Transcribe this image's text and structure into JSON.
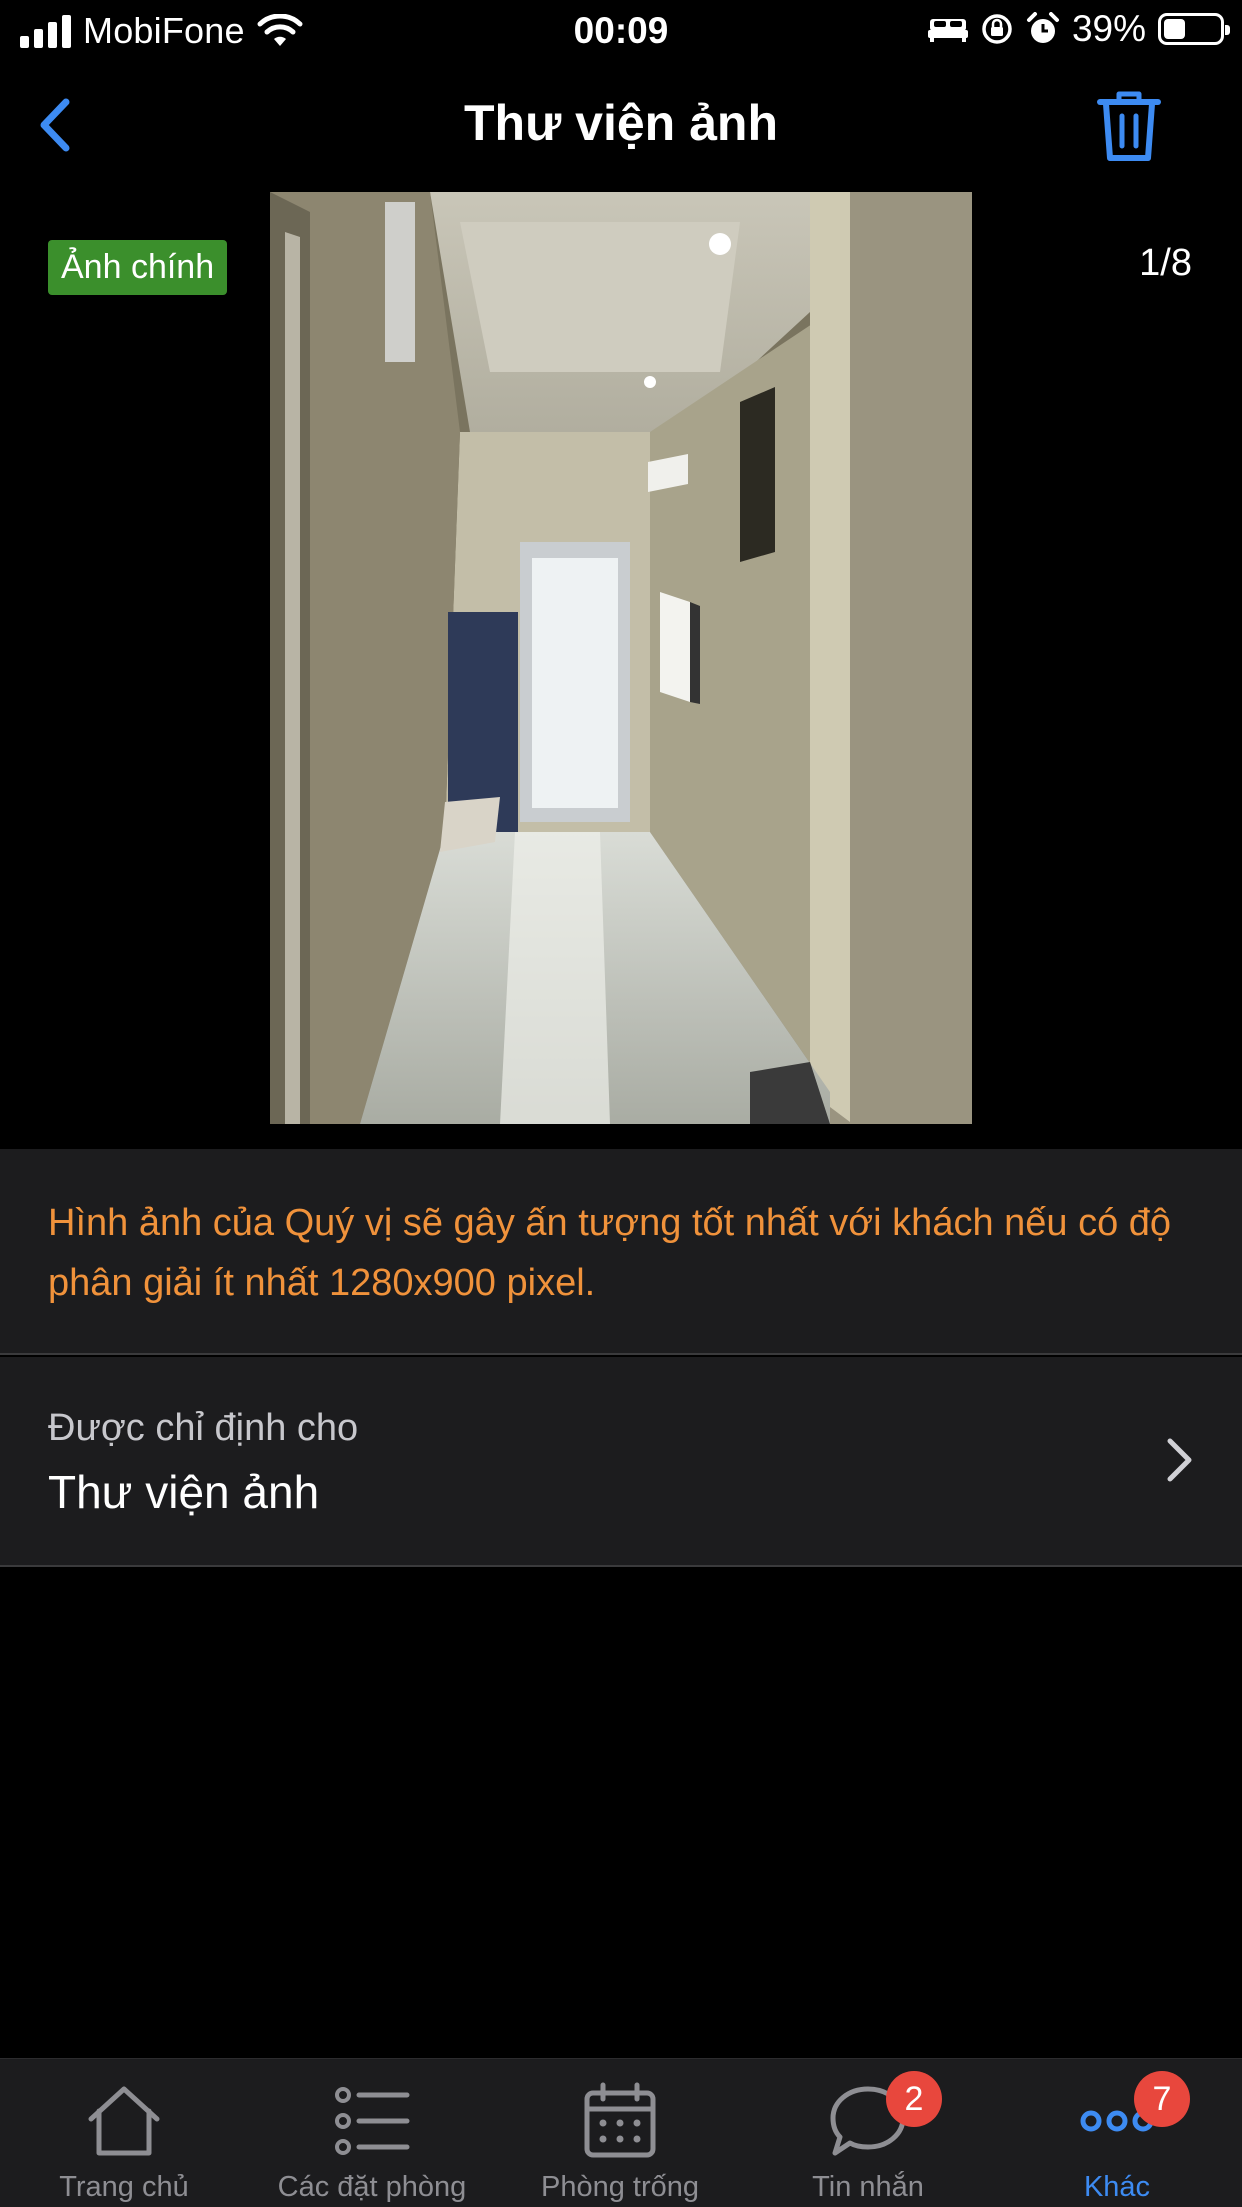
{
  "status_bar": {
    "carrier": "MobiFone",
    "time": "00:09",
    "battery_percent": "39%",
    "battery_level": 0.39
  },
  "nav": {
    "title": "Thư viện ảnh",
    "back_icon": "chevron-left-icon",
    "trash_icon": "trash-icon"
  },
  "photo_viewer": {
    "main_badge": "Ảnh chính",
    "counter": "1/8"
  },
  "hint": {
    "text": "Hình ảnh của Quý vị sẽ gây ấn tượng tốt nhất với khách nếu có độ phân giải ít nhất 1280x900 pixel."
  },
  "assignment": {
    "label": "Được chỉ định cho",
    "value": "Thư viện ảnh"
  },
  "tabbar": {
    "items": [
      {
        "label": "Trang chủ",
        "icon": "home-icon"
      },
      {
        "label": "Các đặt phòng",
        "icon": "list-icon"
      },
      {
        "label": "Phòng trống",
        "icon": "calendar-icon"
      },
      {
        "label": "Tin nhắn",
        "icon": "chat-bubble-icon",
        "badge": "2"
      },
      {
        "label": "Khác",
        "icon": "more-icon",
        "badge": "7",
        "active": true
      }
    ]
  },
  "colors": {
    "accent_blue": "#3d8bf2",
    "badge_green": "#3b8f2c",
    "hint_orange": "#f0923b",
    "badge_red": "#e8473d"
  }
}
